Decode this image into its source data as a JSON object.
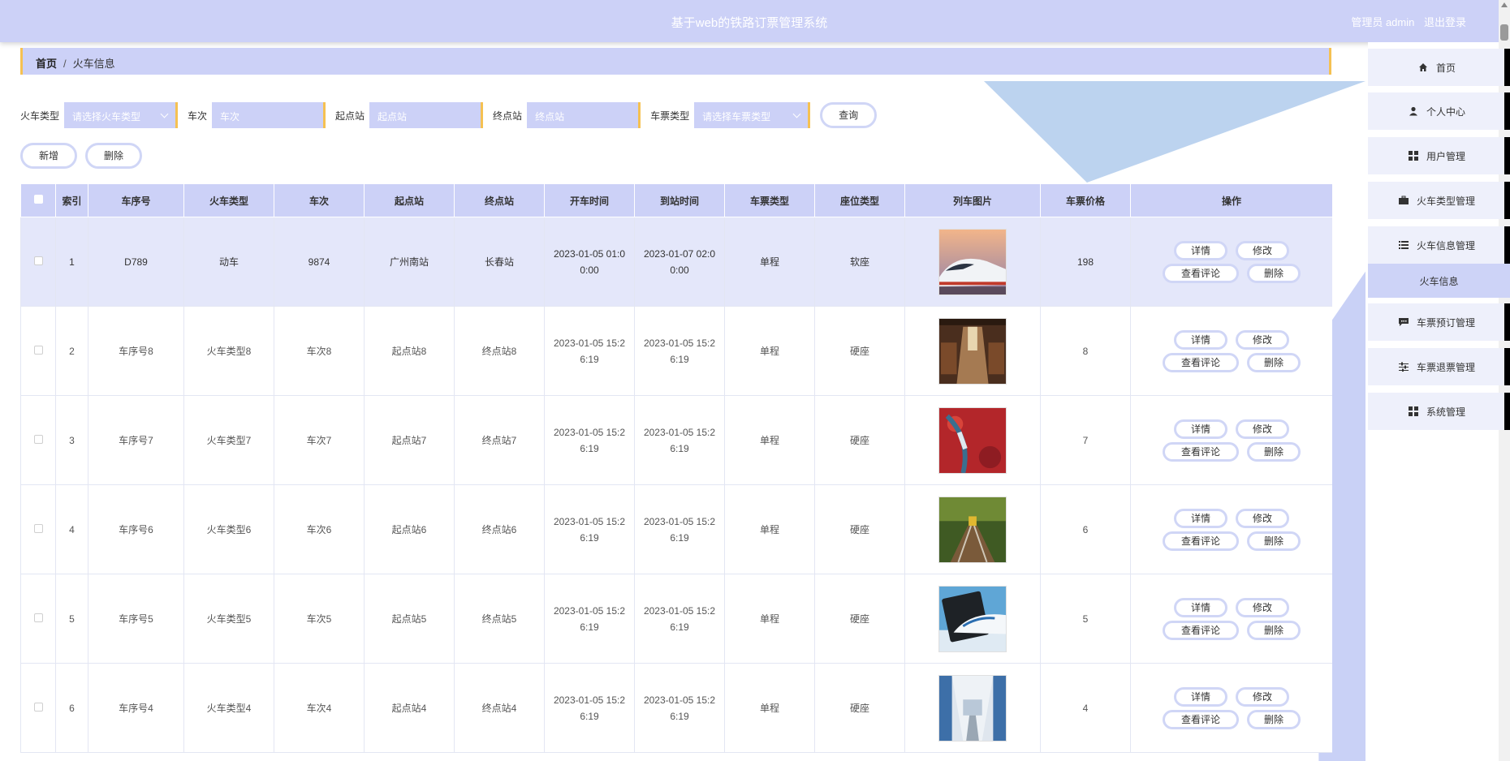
{
  "header": {
    "title": "基于web的铁路订票管理系统",
    "user_label": "管理员 admin",
    "logout_label": "退出登录"
  },
  "breadcrumb": {
    "home": "首页",
    "separator": "/",
    "current": "火车信息"
  },
  "search": {
    "train_type_label": "火车类型",
    "train_type_placeholder": "请选择火车类型",
    "train_no_label": "车次",
    "train_no_placeholder": "车次",
    "start_label": "起点站",
    "start_placeholder": "起点站",
    "end_label": "终点站",
    "end_placeholder": "终点站",
    "ticket_type_label": "车票类型",
    "ticket_type_placeholder": "请选择车票类型",
    "query_label": "查询"
  },
  "toolbar": {
    "add_label": "新增",
    "delete_label": "删除"
  },
  "table": {
    "headers": [
      "索引",
      "车序号",
      "火车类型",
      "车次",
      "起点站",
      "终点站",
      "开车时间",
      "到站时间",
      "车票类型",
      "座位类型",
      "列车图片",
      "车票价格",
      "操作"
    ],
    "actions": {
      "detail": "详情",
      "edit": "修改",
      "comments": "查看评论",
      "delete": "删除"
    },
    "rows": [
      {
        "index": "1",
        "serial": "D789",
        "type": "动车",
        "train_no": "9874",
        "start": "广州南站",
        "end": "长春站",
        "depart": "2023-01-05 01:00:00",
        "arrive": "2023-01-07 02:00:00",
        "ticket": "单程",
        "seat": "软座",
        "image": "white-bullet-train",
        "price": "198"
      },
      {
        "index": "2",
        "serial": "车序号8",
        "type": "火车类型8",
        "train_no": "车次8",
        "start": "起点站8",
        "end": "终点站8",
        "depart": "2023-01-05 15:26:19",
        "arrive": "2023-01-05 15:26:19",
        "ticket": "单程",
        "seat": "硬座",
        "image": "train-interior",
        "price": "8"
      },
      {
        "index": "3",
        "serial": "车序号7",
        "type": "火车类型7",
        "train_no": "车次7",
        "start": "起点站7",
        "end": "终点站7",
        "depart": "2023-01-05 15:26:19",
        "arrive": "2023-01-05 15:26:19",
        "ticket": "单程",
        "seat": "硬座",
        "image": "train-red-field",
        "price": "7"
      },
      {
        "index": "4",
        "serial": "车序号6",
        "type": "火车类型6",
        "train_no": "车次6",
        "start": "起点站6",
        "end": "终点站6",
        "depart": "2023-01-05 15:26:19",
        "arrive": "2023-01-05 15:26:19",
        "ticket": "单程",
        "seat": "硬座",
        "image": "train-forest-track",
        "price": "6"
      },
      {
        "index": "5",
        "serial": "车序号5",
        "type": "火车类型5",
        "train_no": "车次5",
        "start": "起点站5",
        "end": "终点站5",
        "depart": "2023-01-05 15:26:19",
        "arrive": "2023-01-05 15:26:19",
        "ticket": "单程",
        "seat": "硬座",
        "image": "train-tablet",
        "price": "5"
      },
      {
        "index": "6",
        "serial": "车序号4",
        "type": "火车类型4",
        "train_no": "车次4",
        "start": "起点站4",
        "end": "终点站4",
        "depart": "2023-01-05 15:26:19",
        "arrive": "2023-01-05 15:26:19",
        "ticket": "单程",
        "seat": "硬座",
        "image": "train-carriage",
        "price": "4"
      }
    ]
  },
  "sidebar": {
    "items": [
      {
        "label": "首页",
        "icon": "home-icon"
      },
      {
        "label": "个人中心",
        "icon": "user-icon"
      },
      {
        "label": "用户管理",
        "icon": "grid-icon"
      },
      {
        "label": "火车类型管理",
        "icon": "briefcase-icon"
      },
      {
        "label": "火车信息管理",
        "icon": "list-icon"
      },
      {
        "label": "车票预订管理",
        "icon": "comment-icon"
      },
      {
        "label": "车票退票管理",
        "icon": "sliders-icon"
      },
      {
        "label": "系统管理",
        "icon": "grid-icon"
      }
    ],
    "active_sub": "火车信息"
  },
  "colors": {
    "primary": "#ccd1f7",
    "accent": "#f5c152",
    "highlight_row": "#e4e7fa",
    "sidebar_item": "#eef0fb"
  }
}
